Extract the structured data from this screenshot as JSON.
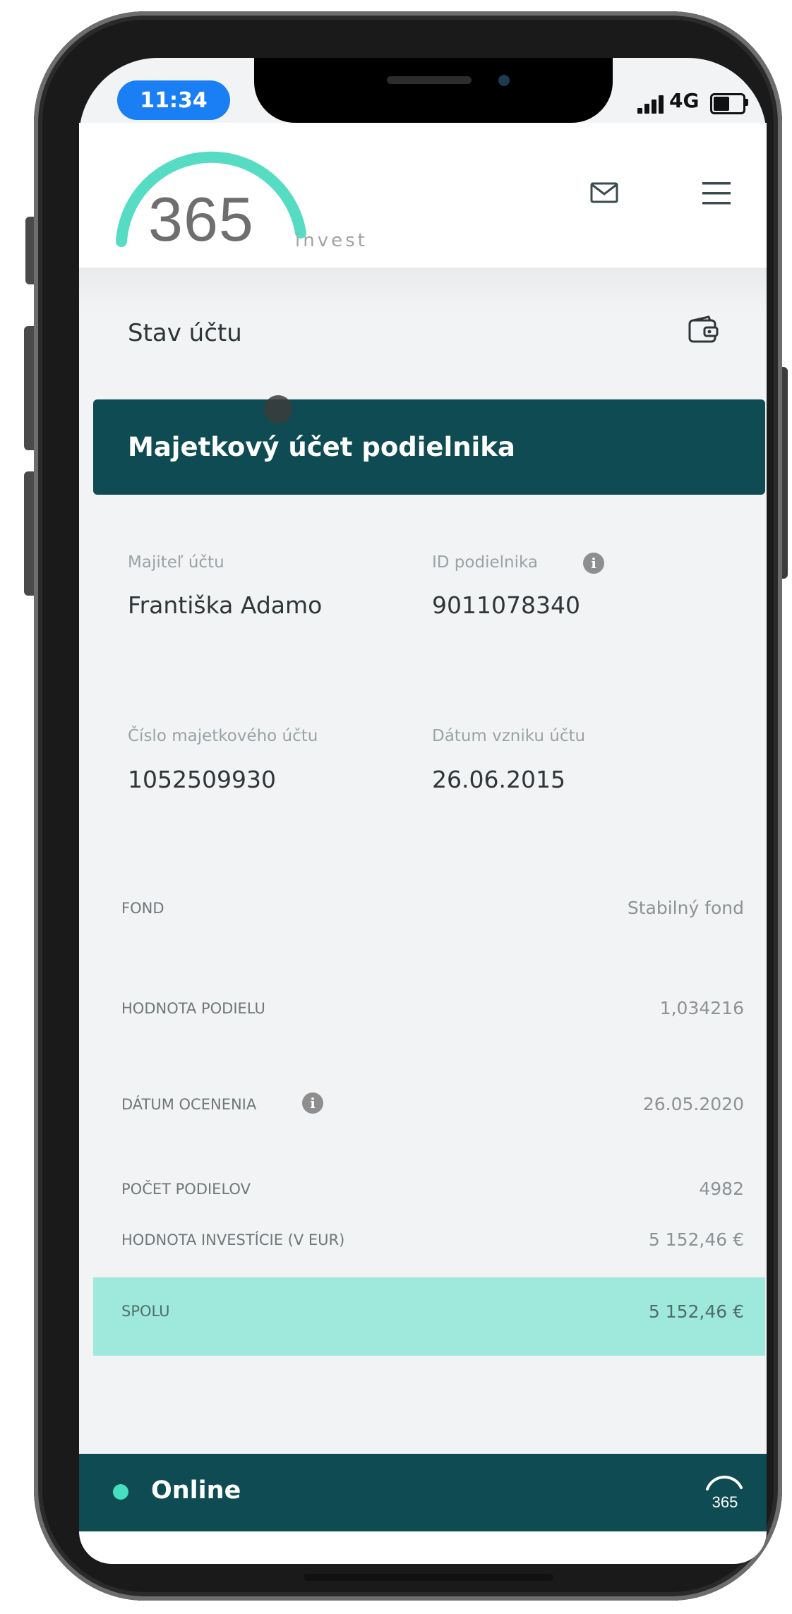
{
  "status_bar": {
    "time": "11:34",
    "network": "4G"
  },
  "header": {
    "logo_number": "365",
    "logo_word": "invest",
    "mail_icon": "mail-icon",
    "menu_icon": "menu-icon"
  },
  "section": {
    "title": "Stav účtu",
    "icon": "wallet-icon"
  },
  "card": {
    "title": "Majetkový účet podielnika"
  },
  "details": [
    {
      "label": "Majiteľ účtu",
      "value": "Františka Adamo"
    },
    {
      "label": "ID podielnika",
      "value": "9011078340"
    },
    {
      "label": "Číslo majetkového účtu",
      "value": "1052509930"
    },
    {
      "label": "Dátum vzniku účtu",
      "value": "26.06.2015"
    }
  ],
  "rows": [
    {
      "label": "FOND",
      "value": "Stabilný fond"
    },
    {
      "label": "HODNOTA PODIELU",
      "value": "1,034216"
    },
    {
      "label": "DÁTUM OCENENIA",
      "value": "26.05.2020"
    },
    {
      "label": "POČET PODIELOV",
      "value": "4982"
    },
    {
      "label": "HODNOTA INVESTÍCIE (V EUR)",
      "value": "5 152,46 €"
    }
  ],
  "total": {
    "label": "SPOLU",
    "value": "5 152,46 €"
  },
  "footer": {
    "status": "Online",
    "logo_number": "365"
  },
  "colors": {
    "accent": "#47ddc0",
    "card": "#0e4b52",
    "total_bg": "#9ee9dc",
    "clock_bg": "#1a7ef5"
  }
}
